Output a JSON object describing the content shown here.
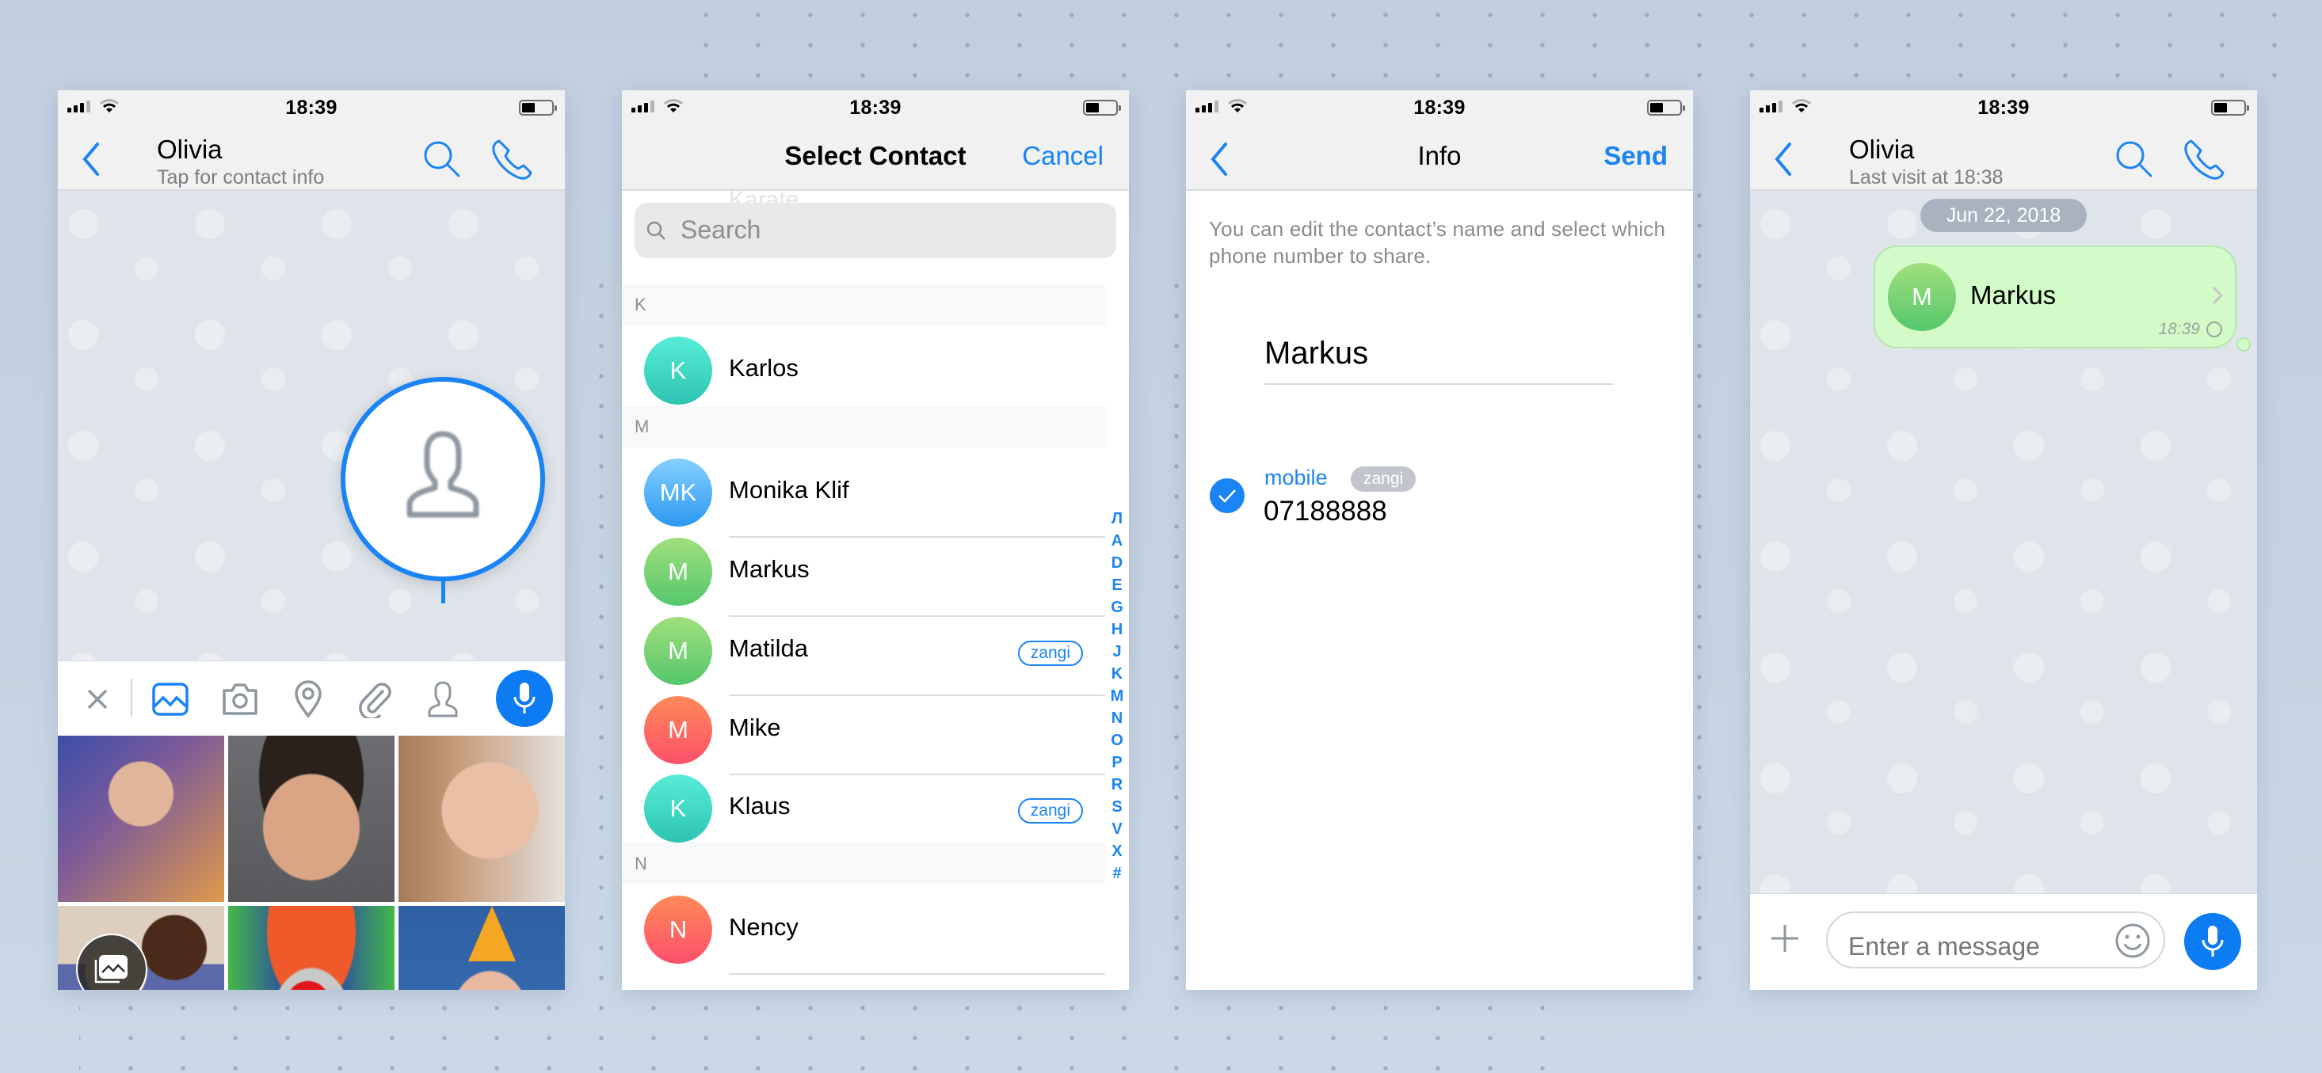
{
  "status_bar": {
    "time": "18:39"
  },
  "screens": {
    "chat_attach": {
      "header": {
        "title": "Olivia",
        "subtitle": "Tap for contact info"
      },
      "toolbar": [
        "close-icon",
        "gallery-icon",
        "camera-icon",
        "location-icon",
        "attachment-icon",
        "contact-icon",
        "microphone-icon"
      ],
      "highlighted_tool": "contact",
      "photos": [
        "woman-portrait",
        "man-smiling",
        "woman-glasses",
        "couple-reading",
        "clown",
        "woman-party-hat"
      ]
    },
    "select_contact": {
      "title": "Select Contact",
      "cancel_label": "Cancel",
      "search_placeholder": "Search",
      "ghost_text": "Karate",
      "sections": [
        {
          "letter": "K",
          "contacts": [
            {
              "initials": "K",
              "name": "Karlos",
              "color": "teal",
              "tag": ""
            }
          ]
        },
        {
          "letter": "M",
          "contacts": [
            {
              "initials": "MK",
              "name": "Monika Klif",
              "color": "blue",
              "tag": ""
            },
            {
              "initials": "M",
              "name": "Markus",
              "color": "green",
              "tag": ""
            },
            {
              "initials": "M",
              "name": "Matilda",
              "color": "green",
              "tag": "zangi"
            },
            {
              "initials": "M",
              "name": "Mike",
              "color": "red",
              "tag": ""
            },
            {
              "initials": "K",
              "name": "Klaus",
              "color": "teal",
              "tag": "zangi"
            }
          ]
        },
        {
          "letter": "N",
          "contacts": [
            {
              "initials": "N",
              "name": "Nency",
              "color": "red",
              "tag": ""
            }
          ]
        }
      ],
      "index_letters": [
        "Л",
        "A",
        "D",
        "E",
        "G",
        "H",
        "J",
        "K",
        "M",
        "N",
        "O",
        "P",
        "R",
        "S",
        "V",
        "X",
        "#"
      ]
    },
    "info": {
      "title": "Info",
      "send_label": "Send",
      "hint": "You can edit the contact’s name and select which phone number to share.",
      "contact_name": "Markus",
      "phone": {
        "label": "mobile",
        "tag": "zangi",
        "number": "07188888",
        "selected": true
      }
    },
    "chat_sent": {
      "header": {
        "title": "Olivia",
        "subtitle": "Last visit at 18:38"
      },
      "date": "Jun 22, 2018",
      "message": {
        "initials": "M",
        "name": "Markus",
        "time": "18:39",
        "status": "pending"
      },
      "input_placeholder": "Enter a message"
    }
  },
  "colors": {
    "accent": "#1a84f5",
    "bubble": "#d2fbc8"
  }
}
